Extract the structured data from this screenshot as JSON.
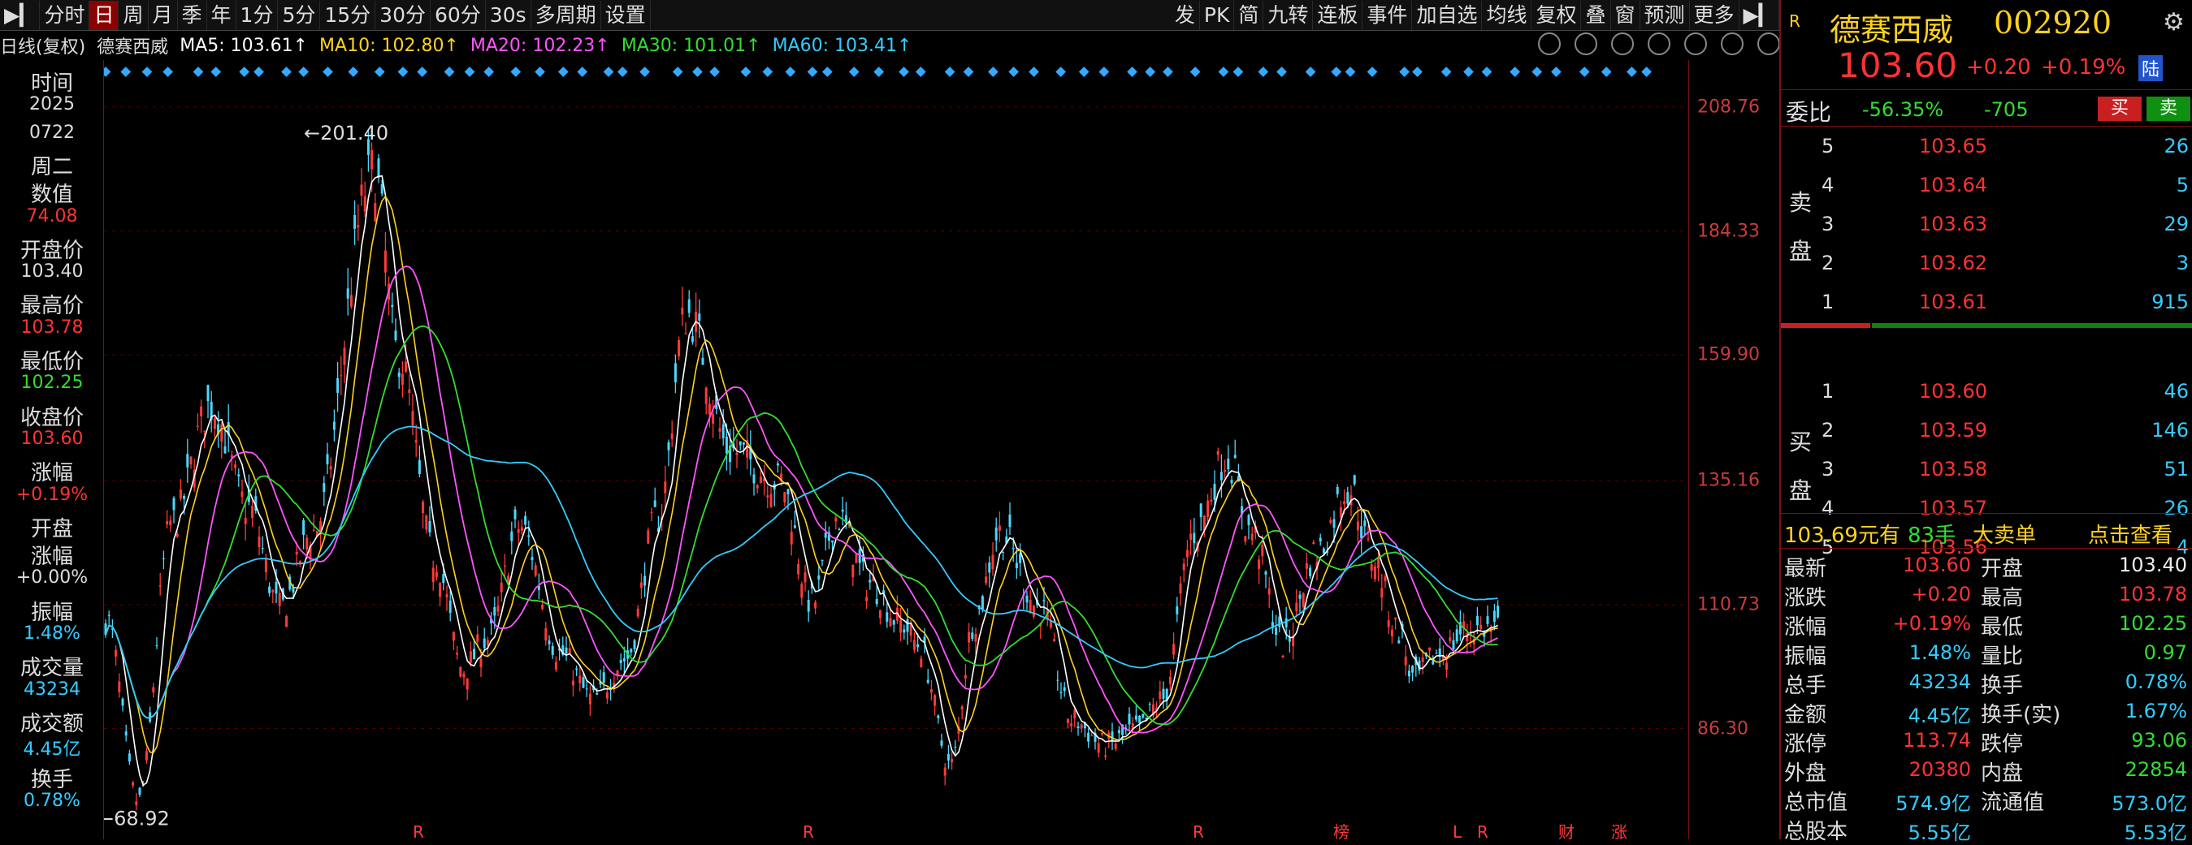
{
  "toolbar": {
    "items": [
      "分时",
      "日",
      "周",
      "月",
      "季",
      "年",
      "1分",
      "5分",
      "15分",
      "30分",
      "60分",
      "30s",
      "多周期",
      "设置"
    ],
    "right_items": [
      "发",
      "PK",
      "简",
      "九转",
      "连板",
      "事件",
      "加自选",
      "均线",
      "复权",
      "叠",
      "窗",
      "预测",
      "更多"
    ]
  },
  "subbar": {
    "mode": "日线(复权)",
    "name": "德赛西威",
    "ma": [
      {
        "label": "MA5: 103.61↑",
        "color": "#ffffff"
      },
      {
        "label": "MA10: 102.80↑",
        "color": "#ffd21e"
      },
      {
        "label": "MA20: 102.23↑",
        "color": "#ff55ff"
      },
      {
        "label": "MA30: 101.01↑",
        "color": "#33dd33"
      },
      {
        "label": "MA60: 103.41↑",
        "color": "#33ccff"
      }
    ]
  },
  "info_panel": {
    "time_label": "时间",
    "year": "2025",
    "date": "0722",
    "weekday": "周二",
    "value_label": "数值",
    "value": "74.08",
    "open_label": "开盘价",
    "open": "103.40",
    "high_label": "最高价",
    "high": "103.78",
    "low_label": "最低价",
    "low": "102.25",
    "close_label": "收盘价",
    "close": "103.60",
    "change_label": "涨幅",
    "change": "+0.19%",
    "open_change_label1": "开盘",
    "open_change_label2": "涨幅",
    "open_change": "+0.00%",
    "amplitude_label": "振幅",
    "amplitude": "1.48%",
    "volume_label": "成交量",
    "volume": "43234",
    "amount_label": "成交额",
    "amount": "4.45亿",
    "turnover_label": "换手",
    "turnover": "0.78%"
  },
  "chart_data": {
    "type": "line",
    "yticks": [
      208.76,
      184.33,
      159.9,
      135.16,
      110.73,
      86.3
    ],
    "ylim": [
      64.5,
      218
    ],
    "peak_label": "201.40",
    "trough_label": "68.92",
    "series": [
      {
        "name": "MA5",
        "color": "#ffffff"
      },
      {
        "name": "MA10",
        "color": "#ffd21e"
      },
      {
        "name": "MA20",
        "color": "#ff55ff"
      },
      {
        "name": "MA30",
        "color": "#33dd33"
      },
      {
        "name": "MA60",
        "color": "#33ccff"
      }
    ],
    "price_path": [
      [
        0,
        108
      ],
      [
        40,
        72
      ],
      [
        82,
        127
      ],
      [
        130,
        150
      ],
      [
        175,
        130
      ],
      [
        215,
        110
      ],
      [
        255,
        125
      ],
      [
        330,
        196
      ],
      [
        360,
        160
      ],
      [
        405,
        120
      ],
      [
        440,
        98
      ],
      [
        470,
        104
      ],
      [
        510,
        126
      ],
      [
        560,
        101
      ],
      [
        600,
        92
      ],
      [
        640,
        100
      ],
      [
        680,
        128
      ],
      [
        715,
        168
      ],
      [
        770,
        141
      ],
      [
        830,
        135
      ],
      [
        870,
        111
      ],
      [
        900,
        128
      ],
      [
        940,
        115
      ],
      [
        980,
        107
      ],
      [
        1000,
        103
      ],
      [
        1040,
        79
      ],
      [
        1070,
        108
      ],
      [
        1100,
        125
      ],
      [
        1150,
        110
      ],
      [
        1190,
        88
      ],
      [
        1230,
        83
      ],
      [
        1270,
        86
      ],
      [
        1300,
        92
      ],
      [
        1340,
        125
      ],
      [
        1380,
        140
      ],
      [
        1410,
        125
      ],
      [
        1450,
        103
      ],
      [
        1490,
        121
      ],
      [
        1530,
        134
      ],
      [
        1560,
        120
      ],
      [
        1590,
        106
      ],
      [
        1610,
        96
      ],
      [
        1640,
        101
      ],
      [
        1680,
        106
      ],
      [
        1720,
        106
      ]
    ],
    "bottom_markers": [
      "R",
      "R",
      "R",
      "R",
      "R",
      "榜",
      "L",
      "财",
      "涨"
    ]
  },
  "quote": {
    "badge": "R",
    "name": "德赛西威",
    "code": "002920",
    "price": "103.60",
    "change": "+0.20",
    "change_pct": "+0.19%",
    "tag": "陆",
    "wb_label": "委比",
    "wb": "-56.35%",
    "wc": "-705",
    "buy_btn": "买",
    "sell_btn": "卖",
    "sell_label": "卖盘",
    "buy_label": "买盘",
    "asks": [
      [
        "5",
        "103.65",
        "26"
      ],
      [
        "4",
        "103.64",
        "5"
      ],
      [
        "3",
        "103.63",
        "29"
      ],
      [
        "2",
        "103.62",
        "3"
      ],
      [
        "1",
        "103.61",
        "915"
      ]
    ],
    "bids": [
      [
        "1",
        "103.60",
        "46"
      ],
      [
        "2",
        "103.59",
        "146"
      ],
      [
        "3",
        "103.58",
        "51"
      ],
      [
        "4",
        "103.57",
        "26"
      ],
      [
        "5",
        "103.56",
        "4"
      ]
    ],
    "bigorder": {
      "price": "103.69元有",
      "hands": "83手",
      "label": "大卖单",
      "action": "点击查看"
    },
    "stats": [
      [
        "最新",
        "103.60",
        "red",
        "开盘",
        "103.40",
        "white"
      ],
      [
        "涨跌",
        "+0.20",
        "red",
        "最高",
        "103.78",
        "red"
      ],
      [
        "涨幅",
        "+0.19%",
        "red",
        "最低",
        "102.25",
        "green"
      ],
      [
        "振幅",
        "1.48%",
        "cyan",
        "量比",
        "0.97",
        "green"
      ],
      [
        "总手",
        "43234",
        "cyan",
        "换手",
        "0.78%",
        "cyan"
      ],
      [
        "金额",
        "4.45亿",
        "cyan",
        "换手(实)",
        "1.67%",
        "cyan"
      ],
      [
        "涨停",
        "113.74",
        "red",
        "跌停",
        "93.06",
        "green"
      ],
      [
        "外盘",
        "20380",
        "red",
        "内盘",
        "22854",
        "green"
      ],
      [
        "总市值",
        "574.9亿",
        "cyan",
        "流通值",
        "573.0亿",
        "cyan"
      ],
      [
        "总股本",
        "5.55亿",
        "cyan",
        "",
        "5.53亿",
        "cyan"
      ]
    ]
  }
}
